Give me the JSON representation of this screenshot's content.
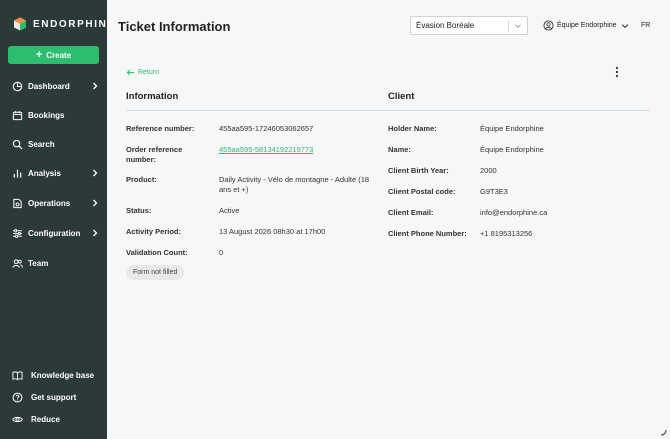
{
  "brand": {
    "name": "ENDORPHINE",
    "accent": "#2dbd6e",
    "sidebar_bg": "#2b3a38"
  },
  "sidebar": {
    "create_label": "Create",
    "items": [
      {
        "label": "Dashboard",
        "icon": "pie-chart-icon",
        "has_chevron": true
      },
      {
        "label": "Bookings",
        "icon": "calendar-icon",
        "has_chevron": false
      },
      {
        "label": "Search",
        "icon": "search-icon",
        "has_chevron": false
      },
      {
        "label": "Analysis",
        "icon": "bar-chart-icon",
        "has_chevron": true
      },
      {
        "label": "Operations",
        "icon": "operations-icon",
        "has_chevron": true
      },
      {
        "label": "Configuration",
        "icon": "sliders-icon",
        "has_chevron": true
      },
      {
        "label": "Team",
        "icon": "team-icon",
        "has_chevron": false
      }
    ],
    "bottom": [
      {
        "label": "Knowledge base",
        "icon": "book-icon"
      },
      {
        "label": "Get support",
        "icon": "help-icon"
      },
      {
        "label": "Reduce",
        "icon": "eye-icon"
      }
    ]
  },
  "header": {
    "title": "Ticket Information",
    "organization": "Évasion Boréale",
    "account": "Équipe Endorphine",
    "language": "FR"
  },
  "content": {
    "return_label": "Return",
    "information": {
      "title": "Information",
      "fields": [
        {
          "label": "Reference number:",
          "value": "455aa595-17246053062657"
        },
        {
          "label": "Order reference number:",
          "value": "455aa595-58134192219773"
        },
        {
          "label": "Product:",
          "value": "Daily Activity - Vélo de montagne - Adulte (18 ans et +)"
        },
        {
          "label": "Status:",
          "value": "Active"
        },
        {
          "label": "Activity Period:",
          "value": "13 August 2026 08h30 at 17h00"
        },
        {
          "label": "Validation Count:",
          "value": "0"
        }
      ],
      "form_status": "Form not filled"
    },
    "client": {
      "title": "Client",
      "fields": [
        {
          "label": "Holder Name:",
          "value": "Équipe Endorphine"
        },
        {
          "label": "Name:",
          "value": "Équipe Endorphine"
        },
        {
          "label": "Client Birth Year:",
          "value": "2000"
        },
        {
          "label": "Client Postal code:",
          "value": "G9T3E3"
        },
        {
          "label": "Client Email:",
          "value": "info@endorphine.ca"
        },
        {
          "label": "Client Phone Number:",
          "value": "+1 8195313256"
        }
      ]
    }
  }
}
